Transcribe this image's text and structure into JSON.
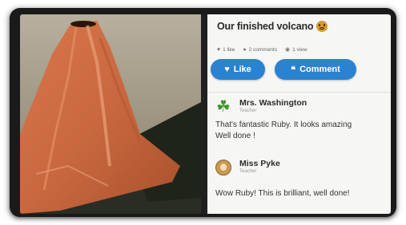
{
  "post": {
    "title": "Our finished volcano",
    "title_emoji": "grimacing-face-emoji",
    "stats": {
      "likes": "1 like",
      "comments": "2 comments",
      "views": "1 view"
    },
    "like_button_label": "Like",
    "comment_button_label": "Comment",
    "accent_color": "#2a83d0"
  },
  "comments": [
    {
      "author": "Mrs. Washington",
      "role": "Teacher",
      "text_line1": "That's fantastic Ruby. It looks amazing",
      "text_line2": "Well done !",
      "avatar_icon": "four-leaf-clover-icon"
    },
    {
      "author": "Miss Pyke",
      "role": "Teacher",
      "text_line1": "Wow Ruby! This is brilliant, well done!",
      "avatar_icon": "profile-avatar-icon"
    }
  ],
  "photo": {
    "subject": "volcano-model-photo"
  }
}
